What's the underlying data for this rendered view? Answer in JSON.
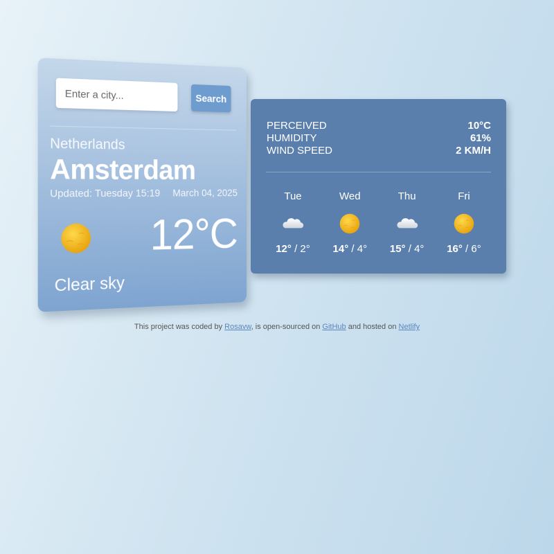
{
  "search": {
    "placeholder": "Enter a city...",
    "button_label": "Search"
  },
  "current": {
    "country": "Netherlands",
    "city": "Amsterdam",
    "updated": "Updated: Tuesday 15:19",
    "date": "March 04, 2025",
    "temperature": "12°C",
    "description": "Clear sky",
    "icon": "sun-icon"
  },
  "stats": [
    {
      "label": "PERCEIVED",
      "value": "10°C"
    },
    {
      "label": "HUMIDITY",
      "value": "61%"
    },
    {
      "label": "WIND SPEED",
      "value": "2 KM/H"
    }
  ],
  "forecast": [
    {
      "day": "Tue",
      "icon": "cloud-icon",
      "high": "12°",
      "sep": " / ",
      "low": "2°"
    },
    {
      "day": "Wed",
      "icon": "sun-icon",
      "high": "14°",
      "sep": " / ",
      "low": "4°"
    },
    {
      "day": "Thu",
      "icon": "cloud-icon",
      "high": "15°",
      "sep": " / ",
      "low": "4°"
    },
    {
      "day": "Fri",
      "icon": "sun-icon",
      "high": "16°",
      "sep": " / ",
      "low": "6°"
    }
  ],
  "footer": {
    "t1": "This project was coded by ",
    "link1": "Rosavw",
    "t2": ", is open-sourced on ",
    "link2": "GitHub",
    "t3": " and hosted on ",
    "link3": "Netlify"
  },
  "colors": {
    "panel": "#5b7fad",
    "button": "#6f9ccf",
    "sun": "#f2b417"
  }
}
